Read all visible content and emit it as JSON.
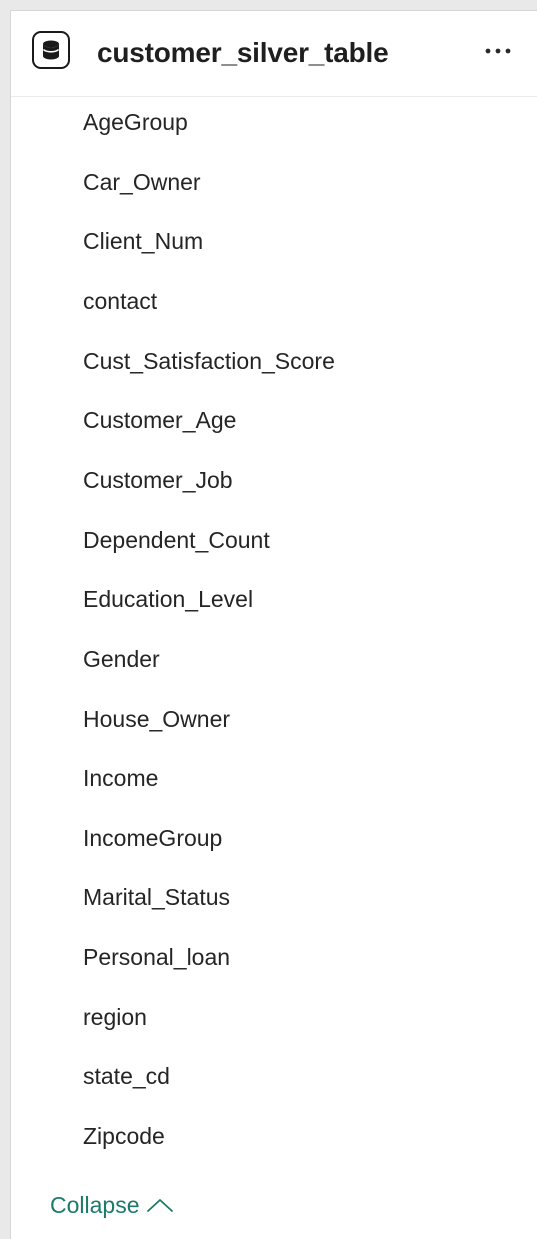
{
  "table": {
    "title": "customer_silver_table",
    "icon": "database-icon",
    "more_icon": "more-horizontal-icon"
  },
  "fields": [
    "AgeGroup",
    "Car_Owner",
    "Client_Num",
    "contact",
    "Cust_Satisfaction_Score",
    "Customer_Age",
    "Customer_Job",
    "Dependent_Count",
    "Education_Level",
    "Gender",
    "House_Owner",
    "Income",
    "IncomeGroup",
    "Marital_Status",
    "Personal_loan",
    "region",
    "state_cd",
    "Zipcode"
  ],
  "footer": {
    "collapse_label": "Collapse",
    "collapse_icon": "chevron-up-icon",
    "accent_color": "#1d7a68"
  }
}
